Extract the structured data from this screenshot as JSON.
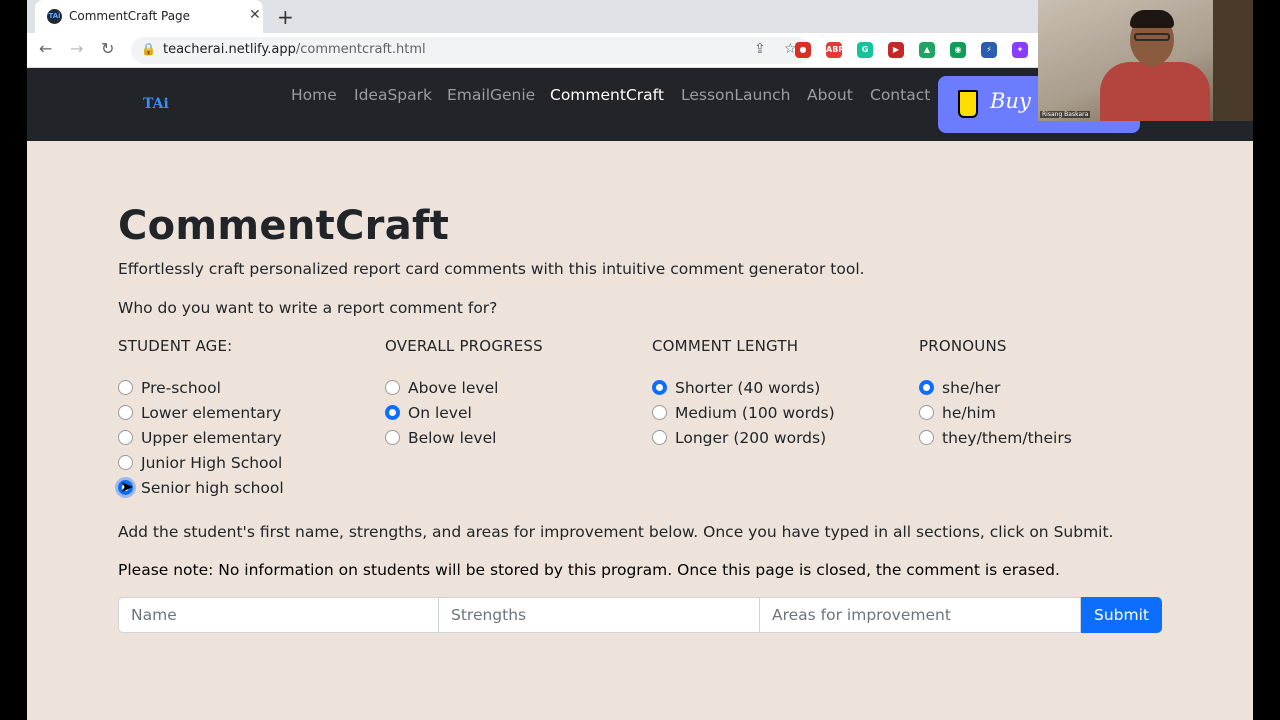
{
  "browser": {
    "tab_title": "CommentCraft Page",
    "tab_favicon": "TAi",
    "close_glyph": "✕",
    "newtab_glyph": "+",
    "back_glyph": "←",
    "forward_glyph": "→",
    "reload_glyph": "↻",
    "lock_glyph": "🔒",
    "share_glyph": "⇪",
    "star_glyph": "☆",
    "url_host": "teacherai.netlify.app",
    "url_path": "/commentcraft.html",
    "extensions": [
      {
        "name": "stop-extension-icon",
        "label": "●",
        "color": "#d93025"
      },
      {
        "name": "adblock-extension-icon",
        "label": "ABP",
        "color": "#e23a35"
      },
      {
        "name": "grammarly-extension-icon",
        "label": "G",
        "color": "#15c39a"
      },
      {
        "name": "media-extension-icon",
        "label": "▶",
        "color": "#c62828"
      },
      {
        "name": "drive-extension-icon",
        "label": "▲",
        "color": "#1fa463"
      },
      {
        "name": "screen-recorder-extension-icon",
        "label": "◉",
        "color": "#0f9d58"
      },
      {
        "name": "bolt-extension-icon",
        "label": "⚡",
        "color": "#2a5db0"
      },
      {
        "name": "sparkle-extension-icon",
        "label": "✦",
        "color": "#8b3dff"
      }
    ]
  },
  "site": {
    "logo": "TAi",
    "nav": [
      "Home",
      "IdeaSpark",
      "EmailGenie",
      "CommentCraft",
      "LessonLaunch",
      "About",
      "Contact"
    ],
    "active_nav": "CommentCraft",
    "coffee_label": "Buy m"
  },
  "webcam": {
    "name": "Risang Baskara"
  },
  "page": {
    "title": "CommentCraft",
    "lead": "Effortlessly craft personalized report card comments with this intuitive comment generator tool.",
    "question": "Who do you want to write a report comment for?",
    "groups": [
      {
        "title": "STUDENT AGE:",
        "options": [
          "Pre-school",
          "Lower elementary",
          "Upper elementary",
          "Junior High School",
          "Senior high school"
        ],
        "selected": 4
      },
      {
        "title": "OVERALL PROGRESS",
        "options": [
          "Above level",
          "On level",
          "Below level"
        ],
        "selected": 1
      },
      {
        "title": "COMMENT LENGTH",
        "options": [
          "Shorter (40 words)",
          "Medium (100 words)",
          "Longer (200 words)"
        ],
        "selected": 0
      },
      {
        "title": "PRONOUNS",
        "options": [
          "she/her",
          "he/him",
          "they/them/theirs"
        ],
        "selected": 0
      }
    ],
    "instructions": "Add the student's first name, strengths, and areas for improvement below. Once you have typed in all sections, click on Submit.",
    "note": "Please note: No information on students will be stored by this program. Once this page is closed, the comment is erased.",
    "form": {
      "name_placeholder": "Name",
      "strengths_placeholder": "Strengths",
      "improvement_placeholder": "Areas for improvement",
      "submit_label": "Submit"
    }
  }
}
